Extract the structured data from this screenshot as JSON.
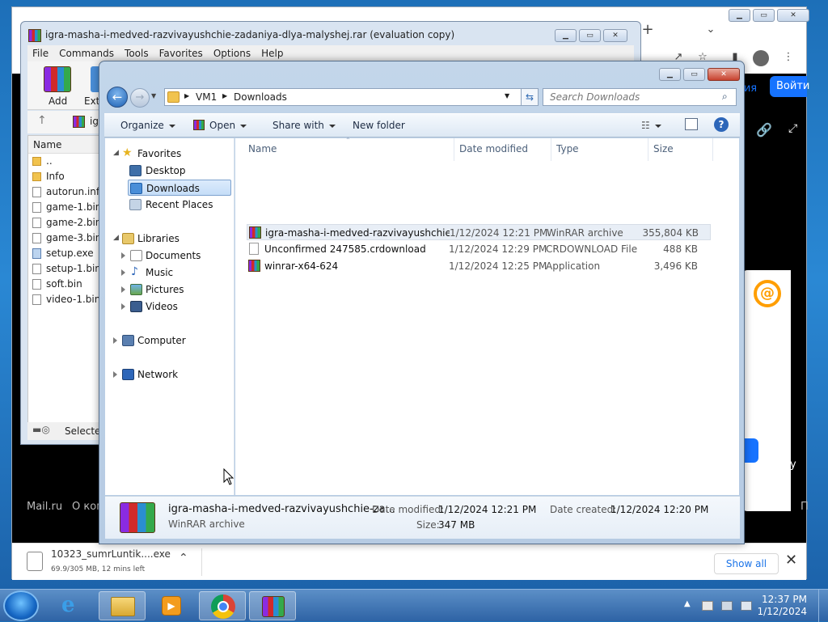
{
  "chrome": {
    "tab_plus": "+",
    "login_button": "Войти",
    "page_partial_text": "ация",
    "footer_mail": "Mail.ru",
    "footer_about": "О ком",
    "right_partial_letter": "у",
    "right_partial_letter2": "П",
    "download": {
      "filename": "10323_sumrLuntik....exe",
      "progress": "69.9/305 MB, 12 mins left",
      "show_all": "Show all"
    }
  },
  "winrar": {
    "title": "igra-masha-i-medved-razvivayushchie-zadaniya-dlya-malyshej.rar (evaluation copy)",
    "menu": [
      "File",
      "Commands",
      "Tools",
      "Favorites",
      "Options",
      "Help"
    ],
    "toolbar": {
      "add": "Add",
      "extract_partial": "Extr"
    },
    "path_partial": "ig",
    "column_name": "Name",
    "files": [
      {
        "name": "..",
        "type": "folder"
      },
      {
        "name": "Info",
        "type": "folder"
      },
      {
        "name": "autorun.inf",
        "type": "file"
      },
      {
        "name": "game-1.bin",
        "type": "file"
      },
      {
        "name": "game-2.bin",
        "type": "file"
      },
      {
        "name": "game-3.bin",
        "type": "file"
      },
      {
        "name": "setup.exe",
        "type": "exe"
      },
      {
        "name": "setup-1.bin",
        "type": "file"
      },
      {
        "name": "soft.bin",
        "type": "file"
      },
      {
        "name": "video-1.bin",
        "type": "file"
      }
    ],
    "status_partial": "Selected"
  },
  "explorer": {
    "breadcrumb": [
      "VM1",
      "Downloads"
    ],
    "search_placeholder": "Search Downloads",
    "commands": {
      "organize": "Organize",
      "open": "Open",
      "share_with": "Share with",
      "new_folder": "New folder"
    },
    "nav": {
      "favorites": "Favorites",
      "desktop": "Desktop",
      "downloads": "Downloads",
      "recent": "Recent Places",
      "libraries": "Libraries",
      "documents": "Documents",
      "music": "Music",
      "pictures": "Pictures",
      "videos": "Videos",
      "computer": "Computer",
      "network": "Network"
    },
    "columns": {
      "name": "Name",
      "date": "Date modified",
      "type": "Type",
      "size": "Size"
    },
    "files": [
      {
        "name": "igra-masha-i-medved-razvivayushchie-z...",
        "date": "1/12/2024 12:21 PM",
        "type": "WinRAR archive",
        "size": "355,804 KB",
        "icon": "rar"
      },
      {
        "name": "Unconfirmed 247585.crdownload",
        "date": "1/12/2024 12:29 PM",
        "type": "CRDOWNLOAD File",
        "size": "488 KB",
        "icon": "blank"
      },
      {
        "name": "winrar-x64-624",
        "date": "1/12/2024 12:25 PM",
        "type": "Application",
        "size": "3,496 KB",
        "icon": "rar"
      }
    ],
    "details": {
      "name": "igra-masha-i-medved-razvivayushchie-za...",
      "type": "WinRAR archive",
      "date_modified_label": "Date modified:",
      "date_modified": "1/12/2024 12:21 PM",
      "date_created_label": "Date created:",
      "date_created": "1/12/2024 12:20 PM",
      "size_label": "Size:",
      "size": "347 MB"
    }
  },
  "taskbar": {
    "time": "12:37 PM",
    "date": "1/12/2024"
  }
}
